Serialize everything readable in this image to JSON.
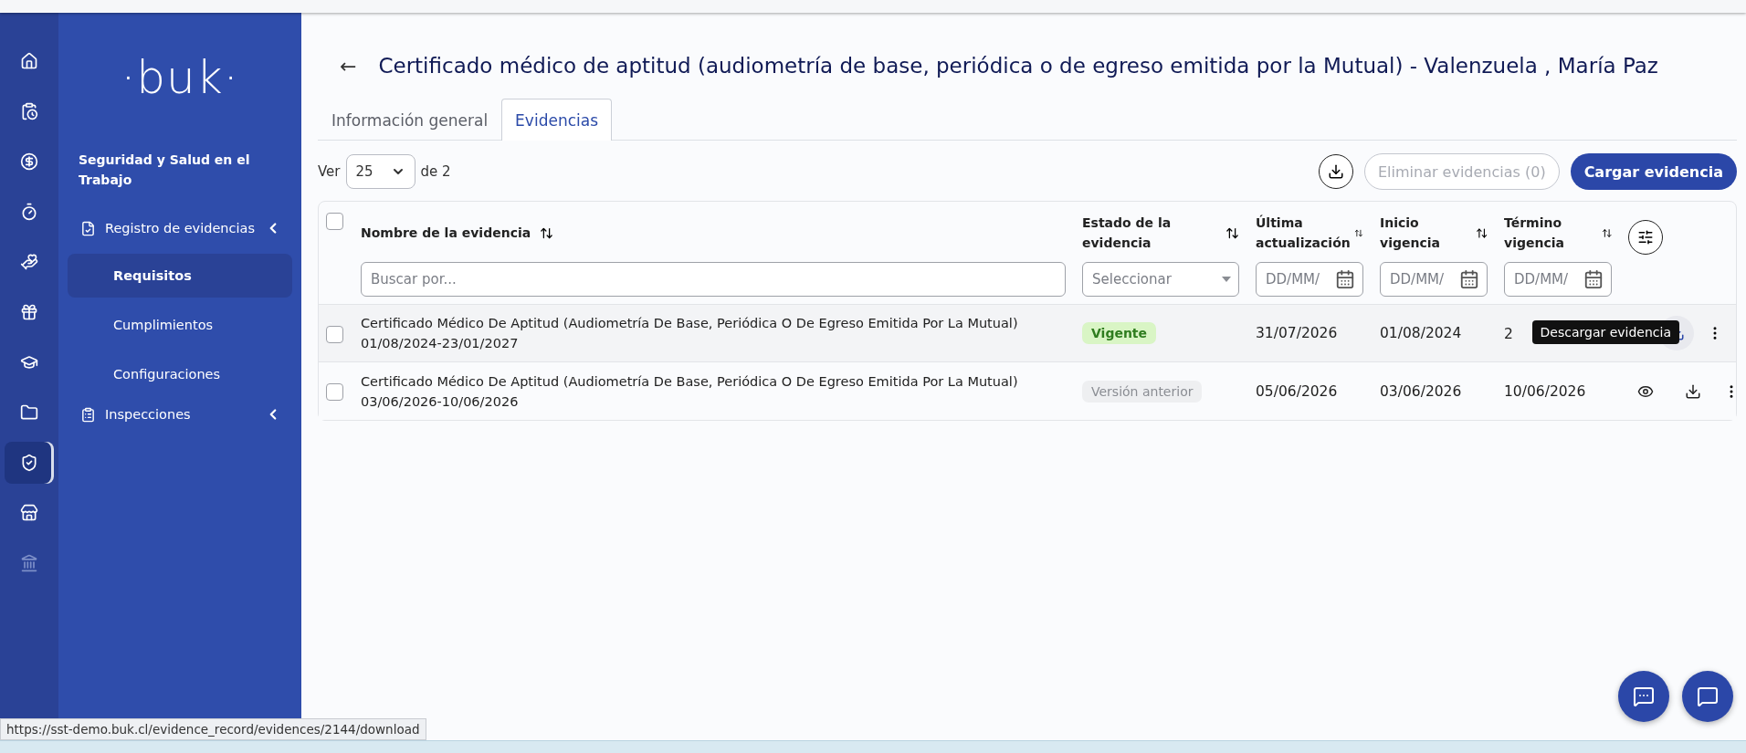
{
  "rail": {
    "items": [
      {
        "selected": false,
        "disabled": false
      },
      {
        "selected": false,
        "disabled": false
      },
      {
        "selected": false,
        "disabled": false
      },
      {
        "selected": false,
        "disabled": false
      },
      {
        "selected": false,
        "disabled": false
      },
      {
        "selected": false,
        "disabled": false
      },
      {
        "selected": false,
        "disabled": false
      },
      {
        "selected": false,
        "disabled": false
      },
      {
        "selected": true,
        "disabled": false
      },
      {
        "selected": false,
        "disabled": false
      },
      {
        "selected": false,
        "disabled": true
      }
    ]
  },
  "sidebar": {
    "logo": "·buk·",
    "section_title": "Seguridad y Salud en el Trabajo",
    "groups": [
      {
        "label": "Registro de evidencias",
        "children": [
          {
            "label": "Requisitos",
            "selected": true
          },
          {
            "label": "Cumplimientos",
            "selected": false
          },
          {
            "label": "Configuraciones",
            "selected": false
          }
        ]
      },
      {
        "label": "Inspecciones"
      }
    ]
  },
  "page": {
    "back": "←",
    "title": "Certificado médico de aptitud (audiometría de base, periódica o de egreso emitida por la Mutual) - Valenzuela , María Paz"
  },
  "tabs": [
    {
      "label": "Información general",
      "selected": false
    },
    {
      "label": "Evidencias",
      "selected": true
    }
  ],
  "toolbar": {
    "show_label": "Ver",
    "page_size": "25",
    "of_label": "de 2",
    "delete_button": {
      "label": "Eliminar evidencias (0)",
      "disabled": true
    },
    "upload_button": "Cargar evidencia"
  },
  "table": {
    "select_all": {
      "checked": false
    },
    "columns": [
      {
        "label": "Nombre de la evidencia",
        "filter": {
          "kind": "text",
          "placeholder": "Buscar por..."
        }
      },
      {
        "label": "Estado de la evidencia",
        "filter": {
          "kind": "select",
          "placeholder": "Seleccionar"
        }
      },
      {
        "label": "Última actualización",
        "filter": {
          "kind": "date",
          "placeholder": "DD/MM/"
        }
      },
      {
        "label": "Inicio vigencia",
        "filter": {
          "kind": "date",
          "placeholder": "DD/MM/"
        }
      },
      {
        "label": "Término vigencia",
        "filter": {
          "kind": "date",
          "placeholder": "DD/MM/"
        }
      }
    ],
    "rows": [
      {
        "name": "Certificado Médico De Aptitud (Audiometría De Base, Periódica O De Egreso Emitida Por La Mutual)",
        "period": "01/08/2024-23/01/2027",
        "status": {
          "label": "Vigente",
          "kind": "current"
        },
        "updated": "31/07/2026",
        "start": "01/08/2024",
        "end": "2",
        "hovered": true,
        "checked": false
      },
      {
        "name": "Certificado Médico De Aptitud (Audiometría De Base, Periódica O De Egreso Emitida Por La Mutual)",
        "period": "03/06/2026-10/06/2026",
        "status": {
          "label": "Versión anterior",
          "kind": "previous"
        },
        "updated": "05/06/2026",
        "start": "03/06/2026",
        "end": "10/06/2026",
        "hovered": false,
        "checked": false
      }
    ]
  },
  "tooltip": "Descargar evidencia",
  "status_bar": "https://sst-demo.buk.cl/evidence_record/evidences/2144/download"
}
